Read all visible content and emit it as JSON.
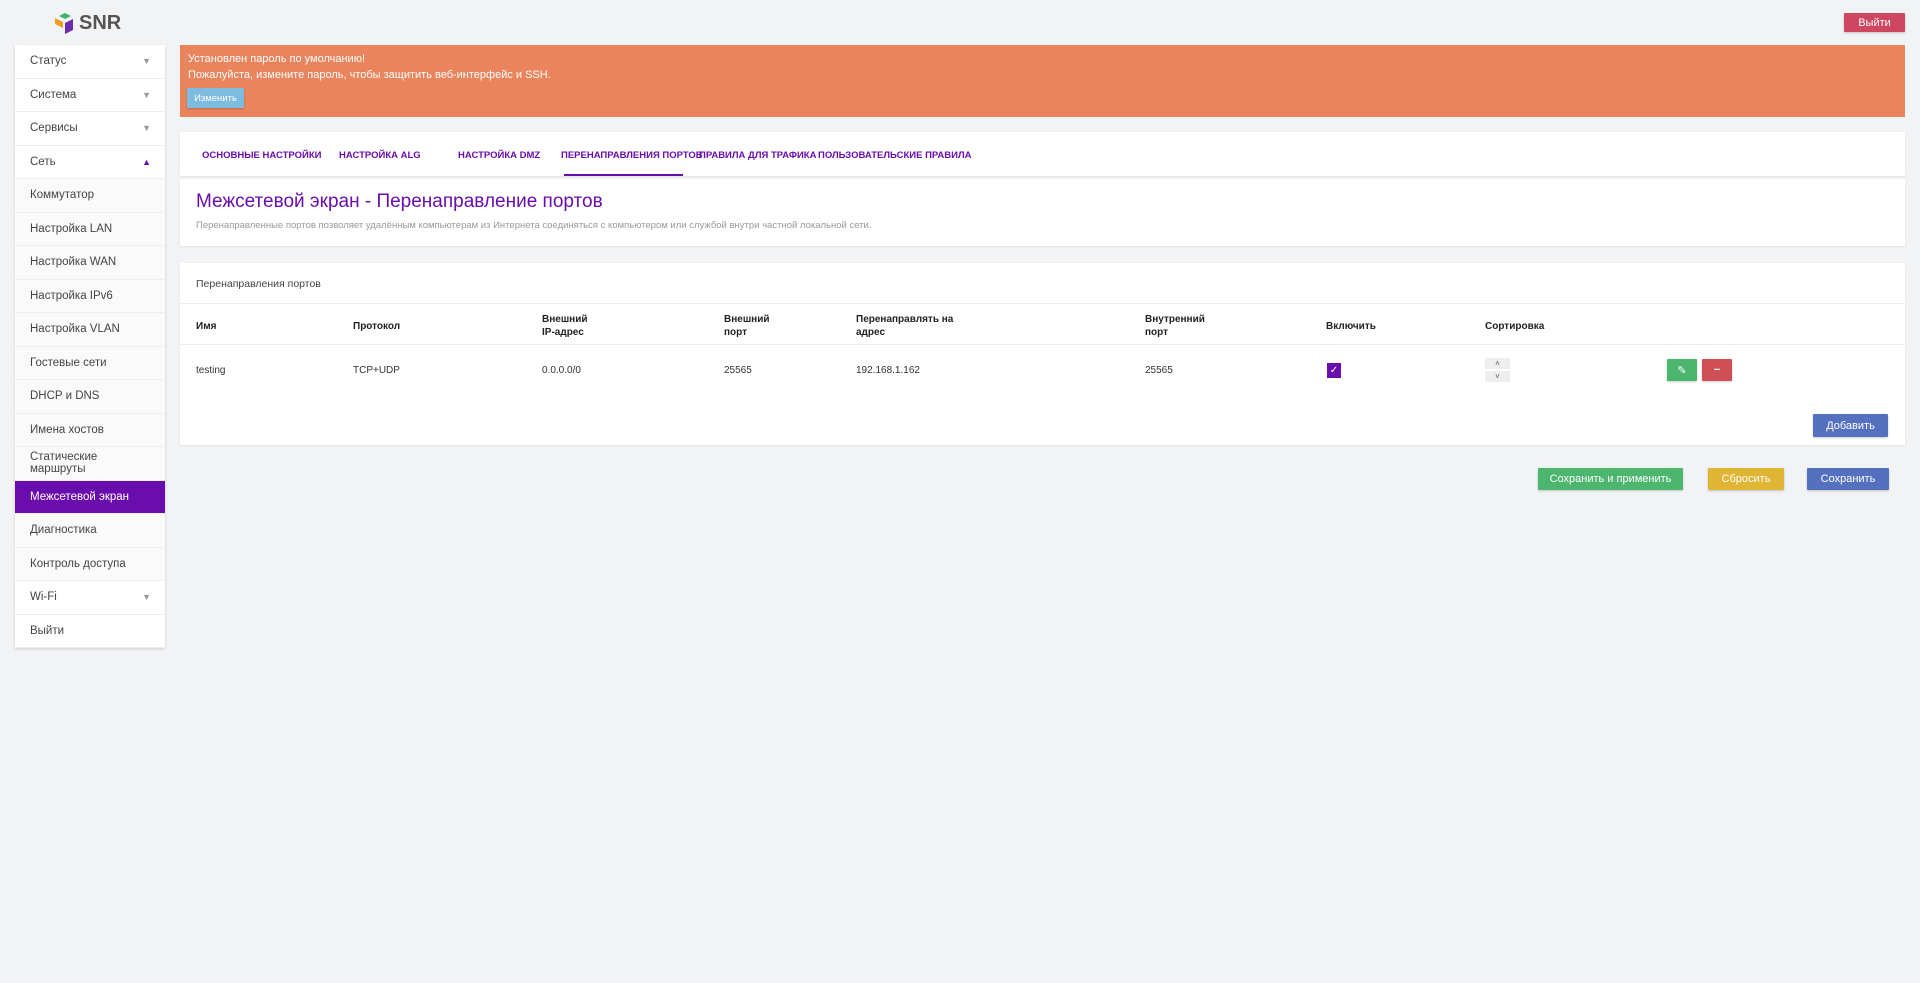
{
  "header": {
    "logo": "SNR",
    "logout_label": "Выйти"
  },
  "sidebar": {
    "items": [
      {
        "label": "Статус",
        "arrow": "▼"
      },
      {
        "label": "Система",
        "arrow": "▼"
      },
      {
        "label": "Сервисы",
        "arrow": "▼"
      },
      {
        "label": "Сеть",
        "arrow": "▲"
      },
      {
        "label": "Коммутатор"
      },
      {
        "label": "Настройка LAN"
      },
      {
        "label": "Настройка WAN"
      },
      {
        "label": "Настройка IPv6"
      },
      {
        "label": "Настройка VLAN"
      },
      {
        "label": "Гостевые сети"
      },
      {
        "label": "DHCP и DNS"
      },
      {
        "label": "Имена хостов"
      },
      {
        "label": "Статические маршруты"
      },
      {
        "label": "Межсетевой экран"
      },
      {
        "label": "Диагностика"
      },
      {
        "label": "Контроль доступа"
      },
      {
        "label": "Wi-Fi",
        "arrow": "▼"
      },
      {
        "label": "Выйти"
      }
    ]
  },
  "banner": {
    "line1": "Установлен пароль по умолчанию!",
    "line2": "Пожалуйста, измените пароль, чтобы защитить веб-интерфейс и SSH.",
    "button": "Изменить"
  },
  "tabs": [
    "Основные настройки",
    "Настройка ALG",
    "Настройка DMZ",
    "Перенаправления портов",
    "Правила для трафика",
    "Пользовательские правила"
  ],
  "page": {
    "title": "Межсетевой экран - Перенаправление портов",
    "description": "Перенаправленные портов позволяет удалённым компьютерам из Интернета соединяться с компьютером или службой внутри частной локальной сети."
  },
  "table": {
    "title": "Перенаправления портов",
    "headers": [
      "Имя",
      "Протокол",
      "Внешний\nIP-адрес",
      "Внешний\nпорт",
      "Перенаправлять на\nадрес",
      "Внутренний\nпорт",
      "Включить",
      "Сортировка"
    ],
    "rows": [
      {
        "name": "testing",
        "protocol": "TCP+UDP",
        "ext_ip": "0.0.0.0/0",
        "ext_port": "25565",
        "dest": "192.168.1.162",
        "int_port": "25565",
        "enabled": true
      }
    ],
    "add_label": "Добавить"
  },
  "actions": {
    "save_apply": "Сохранить и применить",
    "reset": "Сбросить",
    "save": "Сохранить"
  },
  "colors": {
    "accent": "#6a0dad",
    "banner": "#e9845d",
    "green": "#4cb56e",
    "red": "#cf4f57",
    "yellow": "#e0b533",
    "blue": "#5470bf"
  }
}
